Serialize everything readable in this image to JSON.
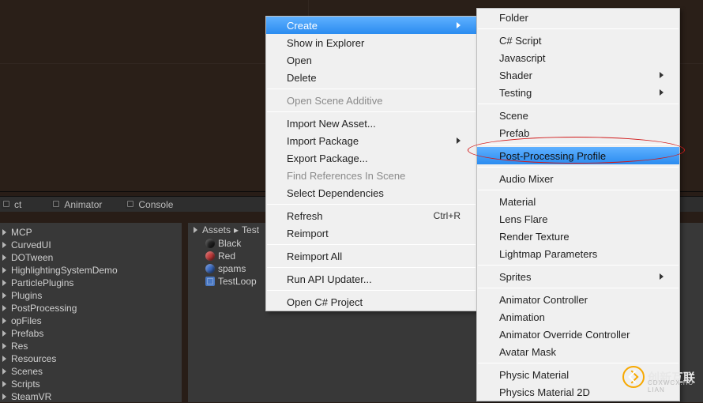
{
  "tabs": {
    "project_tab": "ct",
    "animator_tab": "Animator",
    "console_tab": "Console"
  },
  "hierarchy": {
    "items": [
      "MCP",
      "CurvedUI",
      "DOTween",
      "HighlightingSystemDemo",
      "ParticlePlugins",
      "Plugins",
      "PostProcessing",
      "opFiles",
      "Prefabs",
      "Res",
      "Resources",
      "Scenes",
      "Scripts",
      "SteamVR"
    ]
  },
  "breadcrumb": {
    "root": "Assets",
    "sep": "▸",
    "current": "Test"
  },
  "assets": {
    "items": [
      "Black",
      "Red",
      "spams",
      "TestLoop"
    ]
  },
  "context_menu": {
    "create": "Create",
    "show_in_explorer": "Show in Explorer",
    "open": "Open",
    "delete": "Delete",
    "open_scene_additive": "Open Scene Additive",
    "import_new_asset": "Import New Asset...",
    "import_package": "Import Package",
    "export_package": "Export Package...",
    "find_references": "Find References In Scene",
    "select_dependencies": "Select Dependencies",
    "refresh": "Refresh",
    "refresh_shortcut": "Ctrl+R",
    "reimport": "Reimport",
    "reimport_all": "Reimport All",
    "run_api_updater": "Run API Updater...",
    "open_csharp_project": "Open C# Project"
  },
  "create_submenu": {
    "folder": "Folder",
    "csharp_script": "C# Script",
    "javascript": "Javascript",
    "shader": "Shader",
    "testing": "Testing",
    "scene": "Scene",
    "prefab": "Prefab",
    "post_processing_profile": "Post-Processing Profile",
    "audio_mixer": "Audio Mixer",
    "material": "Material",
    "lens_flare": "Lens Flare",
    "render_texture": "Render Texture",
    "lightmap_parameters": "Lightmap Parameters",
    "sprites": "Sprites",
    "animator_controller": "Animator Controller",
    "animation": "Animation",
    "animator_override_controller": "Animator Override Controller",
    "avatar_mask": "Avatar Mask",
    "physic_material": "Physic Material",
    "physics_material_2d": "Physics Material 2D"
  },
  "watermark": {
    "text": "创新互联",
    "sub": "CDXWCX.HU LIAN"
  },
  "chart_data": null
}
